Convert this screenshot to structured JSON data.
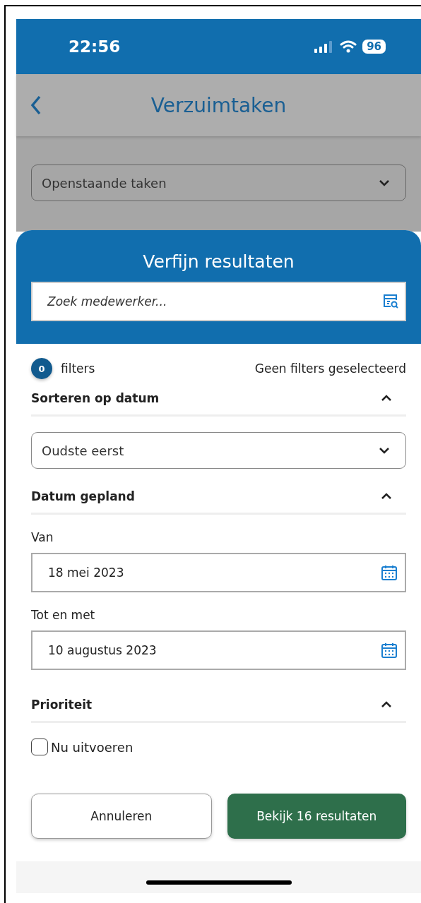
{
  "status_bar": {
    "time": "22:56",
    "battery": "96"
  },
  "header": {
    "title": "Verzuimtaken"
  },
  "task_filter": {
    "value": "Openstaande taken"
  },
  "sheet": {
    "title": "Verfijn resultaten",
    "search": {
      "placeholder": "Zoek medewerker..."
    },
    "filter_count": "0",
    "filter_label": "filters",
    "filter_summary": "Geen filters geselecteerd",
    "sections": [
      {
        "kind": "select",
        "title": "Sorteren op datum",
        "expanded": true,
        "value": "Oudste eerst"
      },
      {
        "kind": "daterange",
        "title": "Datum gepland",
        "expanded": true,
        "fields": [
          {
            "label": "Van",
            "value": "18 mei 2023"
          },
          {
            "label": "Tot en met",
            "value": "10 augustus 2023"
          }
        ]
      },
      {
        "kind": "checkboxes",
        "title": "Prioriteit",
        "expanded": true,
        "options": [
          {
            "label": "Nu uitvoeren",
            "checked": false
          }
        ]
      }
    ],
    "buttons": [
      {
        "label": "Annuleren",
        "kind": "secondary"
      },
      {
        "label": "Bekijk 16 resultaten",
        "kind": "primary"
      }
    ]
  }
}
